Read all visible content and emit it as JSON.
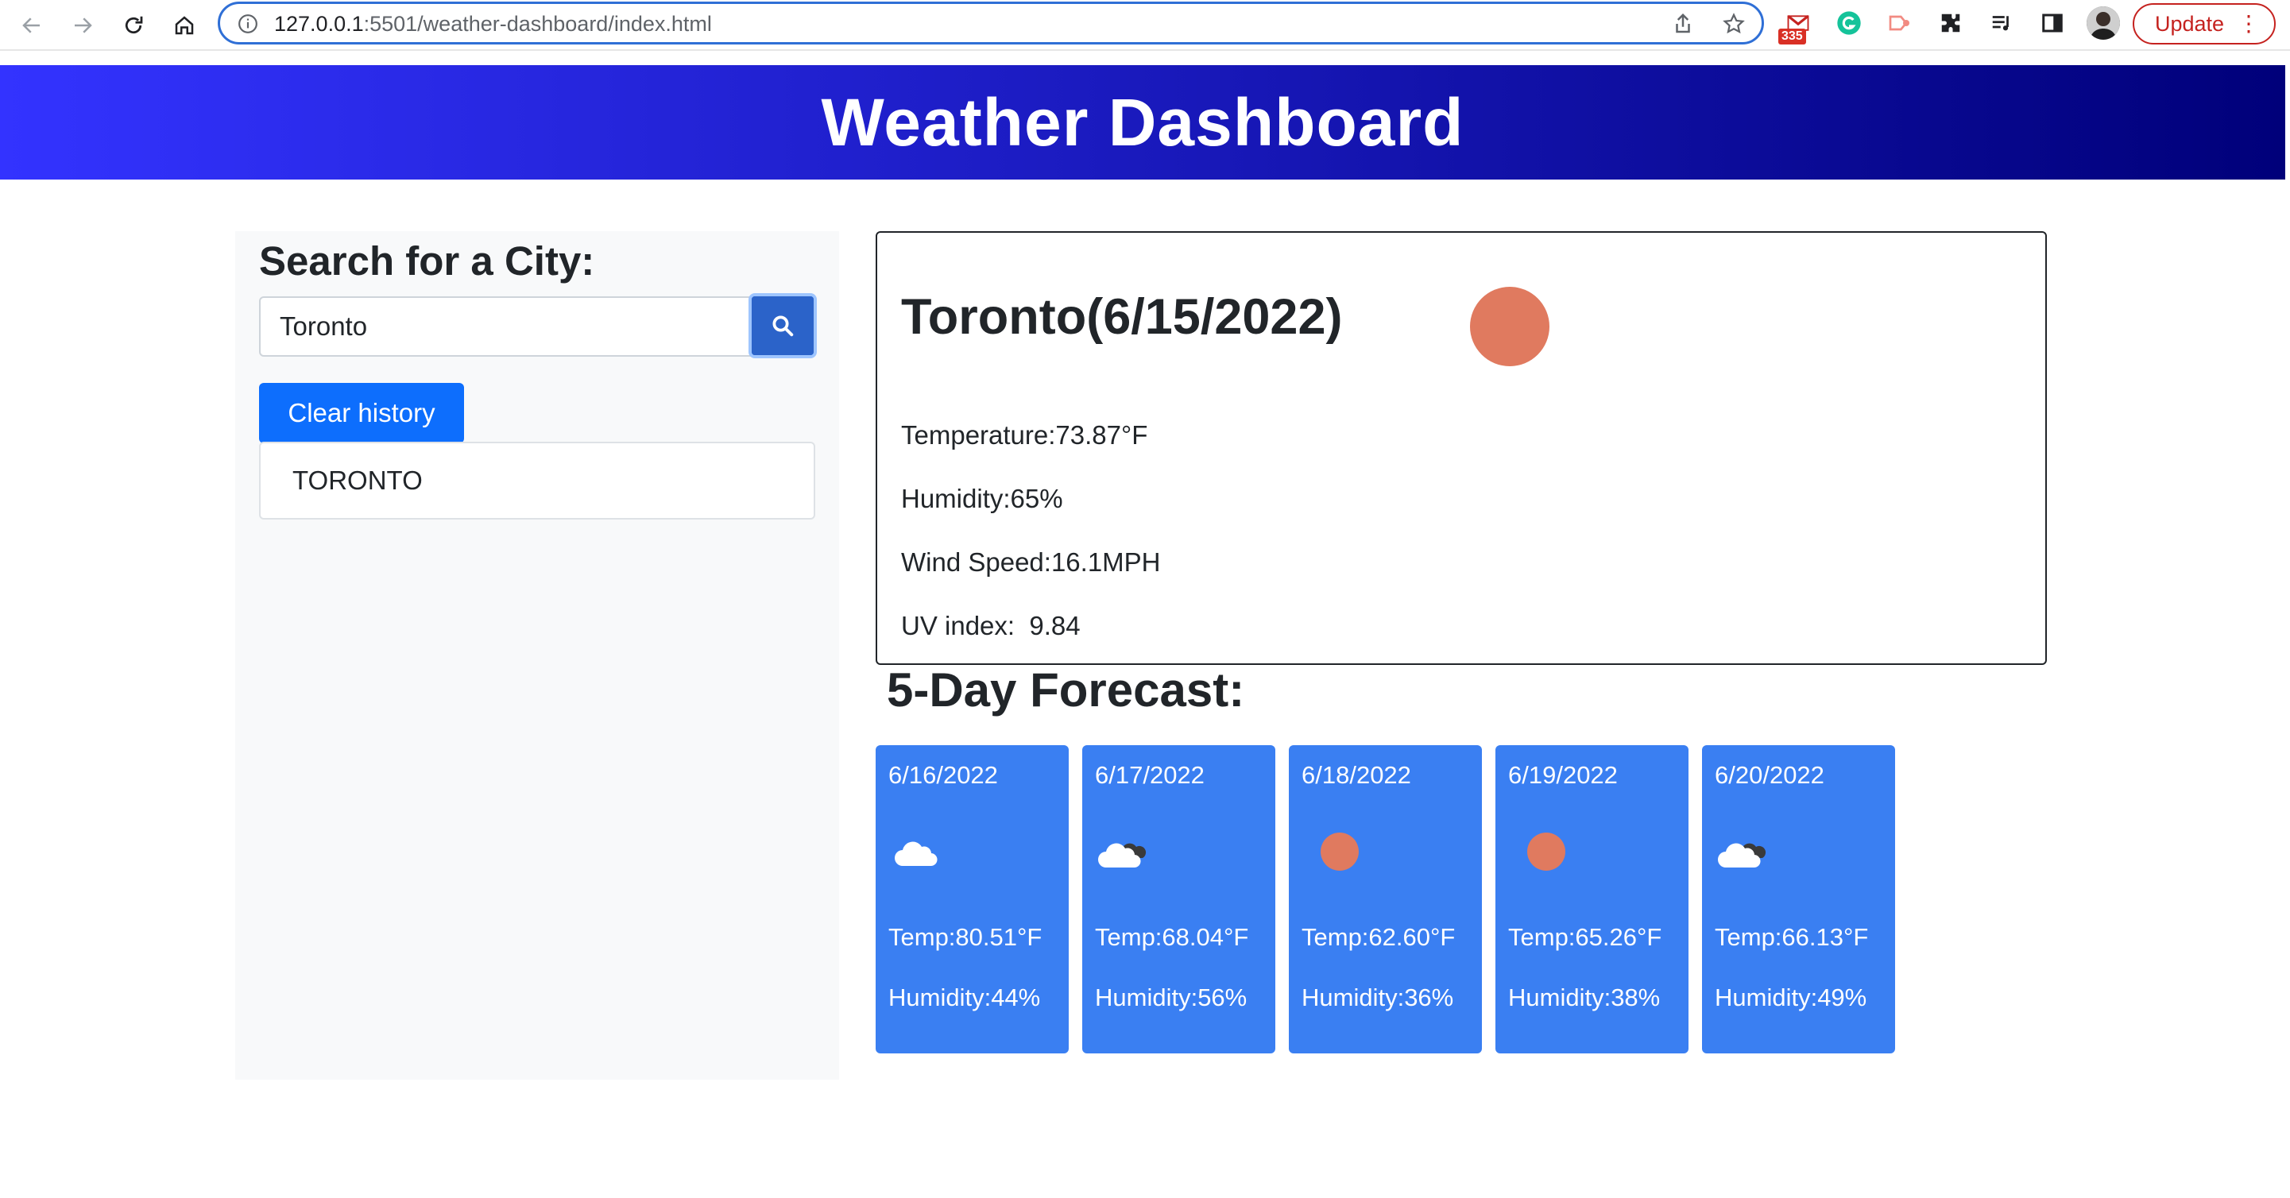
{
  "browser": {
    "url_host": "127.0.0.1",
    "url_path": ":5501/weather-dashboard/index.html",
    "gmail_badge": "335",
    "update_label": "Update",
    "menu_icon": "kebab-menu-icon"
  },
  "header": {
    "title": "Weather Dashboard",
    "gradient_start": "#3333ff",
    "gradient_end": "#00007a"
  },
  "sidebar": {
    "title": "Search for a City:",
    "search_value": "Toronto",
    "clear_label": "Clear history",
    "history": [
      "TORONTO"
    ]
  },
  "current": {
    "title": "Toronto(6/15/2022)",
    "icon": "clear-sun-icon",
    "temperature": "Temperature:73.87°F",
    "humidity": "Humidity:65%",
    "wind": "Wind Speed:16.1MPH",
    "uv": "UV index:  9.84"
  },
  "forecast": {
    "title": "5-Day Forecast:",
    "card_color": "#3a7ff2",
    "days": [
      {
        "date": "6/16/2022",
        "icon": "cloud-icon",
        "temp": "Temp:80.51°F",
        "humidity": "Humidity:44%"
      },
      {
        "date": "6/17/2022",
        "icon": "broken-clouds-icon",
        "temp": "Temp:68.04°F",
        "humidity": "Humidity:56%"
      },
      {
        "date": "6/18/2022",
        "icon": "sun-icon",
        "temp": "Temp:62.60°F",
        "humidity": "Humidity:36%"
      },
      {
        "date": "6/19/2022",
        "icon": "sun-icon",
        "temp": "Temp:65.26°F",
        "humidity": "Humidity:38%"
      },
      {
        "date": "6/20/2022",
        "icon": "broken-clouds-icon",
        "temp": "Temp:66.13°F",
        "humidity": "Humidity:49%"
      }
    ]
  }
}
